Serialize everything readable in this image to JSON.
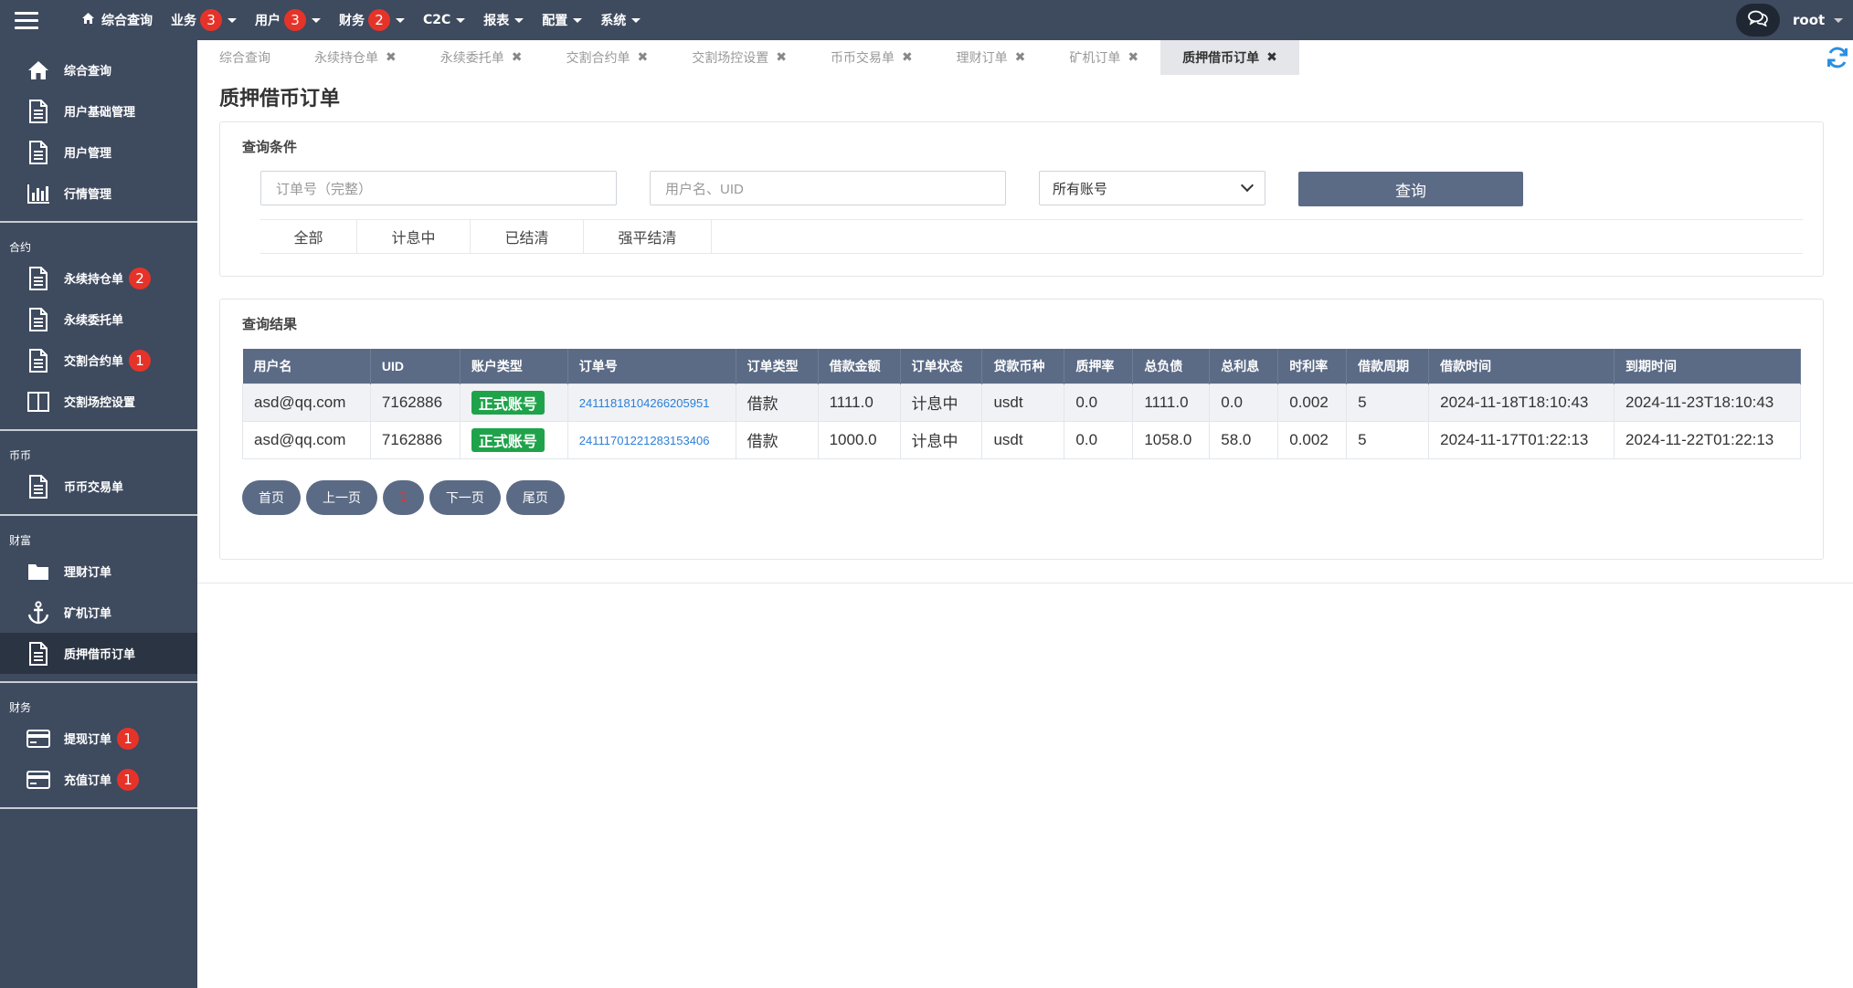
{
  "topnav": {
    "items": [
      {
        "label": "综合查询",
        "badge": null,
        "dropdown": false
      },
      {
        "label": "业务",
        "badge": "3",
        "dropdown": true
      },
      {
        "label": "用户",
        "badge": "3",
        "dropdown": true
      },
      {
        "label": "财务",
        "badge": "2",
        "dropdown": true
      },
      {
        "label": "C2C",
        "badge": null,
        "dropdown": true
      },
      {
        "label": "报表",
        "badge": null,
        "dropdown": true
      },
      {
        "label": "配置",
        "badge": null,
        "dropdown": true
      },
      {
        "label": "系统",
        "badge": null,
        "dropdown": true
      }
    ],
    "user": "root"
  },
  "sidebar": {
    "sections": [
      {
        "heading": "",
        "items": [
          {
            "label": "综合查询",
            "icon": "home-icon",
            "badge": null
          },
          {
            "label": "用户基础管理",
            "icon": "document-icon",
            "badge": null
          },
          {
            "label": "用户管理",
            "icon": "document-icon",
            "badge": null
          },
          {
            "label": "行情管理",
            "icon": "bar-chart-icon",
            "badge": null
          }
        ]
      },
      {
        "heading": "合约",
        "items": [
          {
            "label": "永续持仓单",
            "icon": "document-icon",
            "badge": "2"
          },
          {
            "label": "永续委托单",
            "icon": "document-icon",
            "badge": null
          },
          {
            "label": "交割合约单",
            "icon": "document-icon",
            "badge": "1"
          },
          {
            "label": "交割场控设置",
            "icon": "columns-icon",
            "badge": null
          }
        ]
      },
      {
        "heading": "币币",
        "items": [
          {
            "label": "币币交易单",
            "icon": "document-icon",
            "badge": null
          }
        ]
      },
      {
        "heading": "财富",
        "items": [
          {
            "label": "理财订单",
            "icon": "folder-icon",
            "badge": null
          },
          {
            "label": "矿机订单",
            "icon": "anchor-icon",
            "badge": null
          },
          {
            "label": "质押借币订单",
            "icon": "document-icon",
            "badge": null,
            "active": true
          }
        ]
      },
      {
        "heading": "财务",
        "items": [
          {
            "label": "提现订单",
            "icon": "credit-card-icon",
            "badge": "1"
          },
          {
            "label": "充值订单",
            "icon": "credit-card-icon",
            "badge": "1"
          }
        ]
      }
    ]
  },
  "tabs": [
    {
      "label": "综合查询",
      "closable": false
    },
    {
      "label": "永续持仓单",
      "closable": true
    },
    {
      "label": "永续委托单",
      "closable": true
    },
    {
      "label": "交割合约单",
      "closable": true
    },
    {
      "label": "交割场控设置",
      "closable": true
    },
    {
      "label": "币币交易单",
      "closable": true
    },
    {
      "label": "理财订单",
      "closable": true
    },
    {
      "label": "矿机订单",
      "closable": true
    },
    {
      "label": "质押借币订单",
      "closable": true,
      "active": true
    }
  ],
  "page": {
    "title": "质押借币订单"
  },
  "query": {
    "title": "查询条件",
    "order_placeholder": "订单号（完整）",
    "user_placeholder": "用户名、UID",
    "account_select": "所有账号",
    "button": "查询",
    "filters": [
      "全部",
      "计息中",
      "已结清",
      "强平结清"
    ]
  },
  "results": {
    "title": "查询结果",
    "columns": [
      "用户名",
      "UID",
      "账户类型",
      "订单号",
      "订单类型",
      "借款金额",
      "订单状态",
      "贷款币种",
      "质押率",
      "总负债",
      "总利息",
      "时利率",
      "借款周期",
      "借款时间",
      "到期时间"
    ],
    "rows": [
      {
        "username": "asd@qq.com",
        "uid": "7162886",
        "account_type": "正式账号",
        "order_no": "24111818104266205951",
        "order_type": "借款",
        "amount": "1111.0",
        "status": "计息中",
        "currency": "usdt",
        "pledge_rate": "0.0",
        "total_debt": "1111.0",
        "total_interest": "0.0",
        "hourly_rate": "0.002",
        "period": "5",
        "borrow_time": "2024-11-18T18:10:43",
        "due_time": "2024-11-23T18:10:43"
      },
      {
        "username": "asd@qq.com",
        "uid": "7162886",
        "account_type": "正式账号",
        "order_no": "24111701221283153406",
        "order_type": "借款",
        "amount": "1000.0",
        "status": "计息中",
        "currency": "usdt",
        "pledge_rate": "0.0",
        "total_debt": "1058.0",
        "total_interest": "58.0",
        "hourly_rate": "0.002",
        "period": "5",
        "borrow_time": "2024-11-17T01:22:13",
        "due_time": "2024-11-22T01:22:13"
      }
    ]
  },
  "pager": {
    "first": "首页",
    "prev": "上一页",
    "current": "1",
    "next": "下一页",
    "last": "尾页"
  },
  "colors": {
    "nav_bg": "#3e4a5e",
    "accent": "#5b6b86",
    "badge_red": "#e6332a",
    "account_green": "#1fa34a",
    "link_blue": "#2b7fd8"
  }
}
